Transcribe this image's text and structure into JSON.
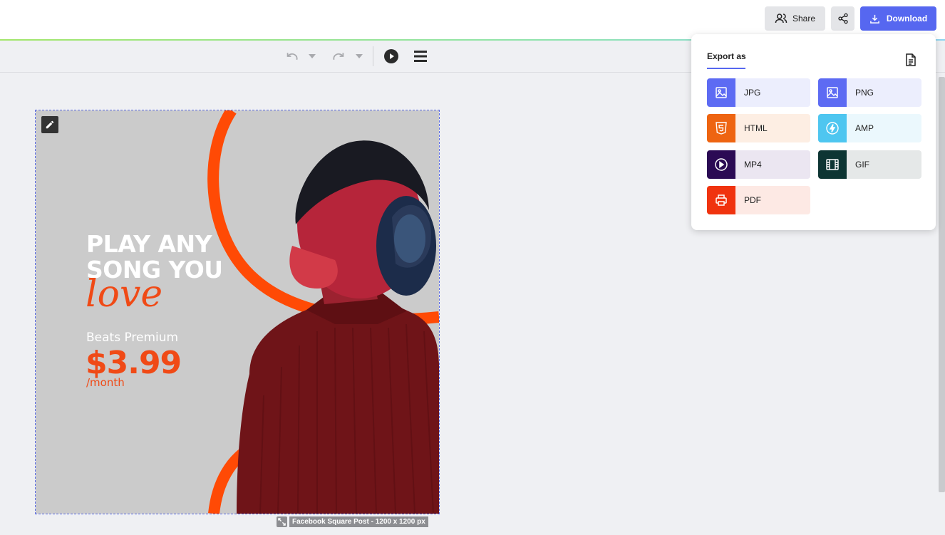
{
  "header": {
    "share_label": "Share",
    "download_label": "Download",
    "icons": [
      "users-icon",
      "link-share-icon",
      "download-icon"
    ]
  },
  "toolbar": {
    "icons": [
      "undo-icon",
      "undo-dropdown-icon",
      "redo-icon",
      "redo-dropdown-icon",
      "play-icon",
      "menu-icon"
    ]
  },
  "design": {
    "headline_line1": "PLAY ANY",
    "headline_line2": "SONG YOU",
    "script_word": "love",
    "plan_name": "Beats Premium",
    "price": "$3.99",
    "period": "/month",
    "colors": {
      "accent": "#f04a16",
      "background": "#cbcbcb"
    }
  },
  "canvas_size_label": "Facebook Square Post - 1200 x 1200 px",
  "export": {
    "title": "Export as",
    "options": [
      {
        "label": "JPG",
        "icon": "image-icon",
        "color": "#5d6bf3",
        "bg": "#eceefd"
      },
      {
        "label": "PNG",
        "icon": "image-icon",
        "color": "#5d6bf3",
        "bg": "#eceefd"
      },
      {
        "label": "HTML",
        "icon": "html5-icon",
        "color": "#ee6411",
        "bg": "#fdeee3"
      },
      {
        "label": "AMP",
        "icon": "amp-bolt-icon",
        "color": "#4ec6f0",
        "bg": "#ebf8fd"
      },
      {
        "label": "MP4",
        "icon": "video-play-icon",
        "color": "#2b0a54",
        "bg": "#ebe6f1"
      },
      {
        "label": "GIF",
        "icon": "film-icon",
        "color": "#0d3533",
        "bg": "#e5e8e8"
      },
      {
        "label": "PDF",
        "icon": "printer-icon",
        "color": "#f0330f",
        "bg": "#fde9e4"
      }
    ]
  }
}
